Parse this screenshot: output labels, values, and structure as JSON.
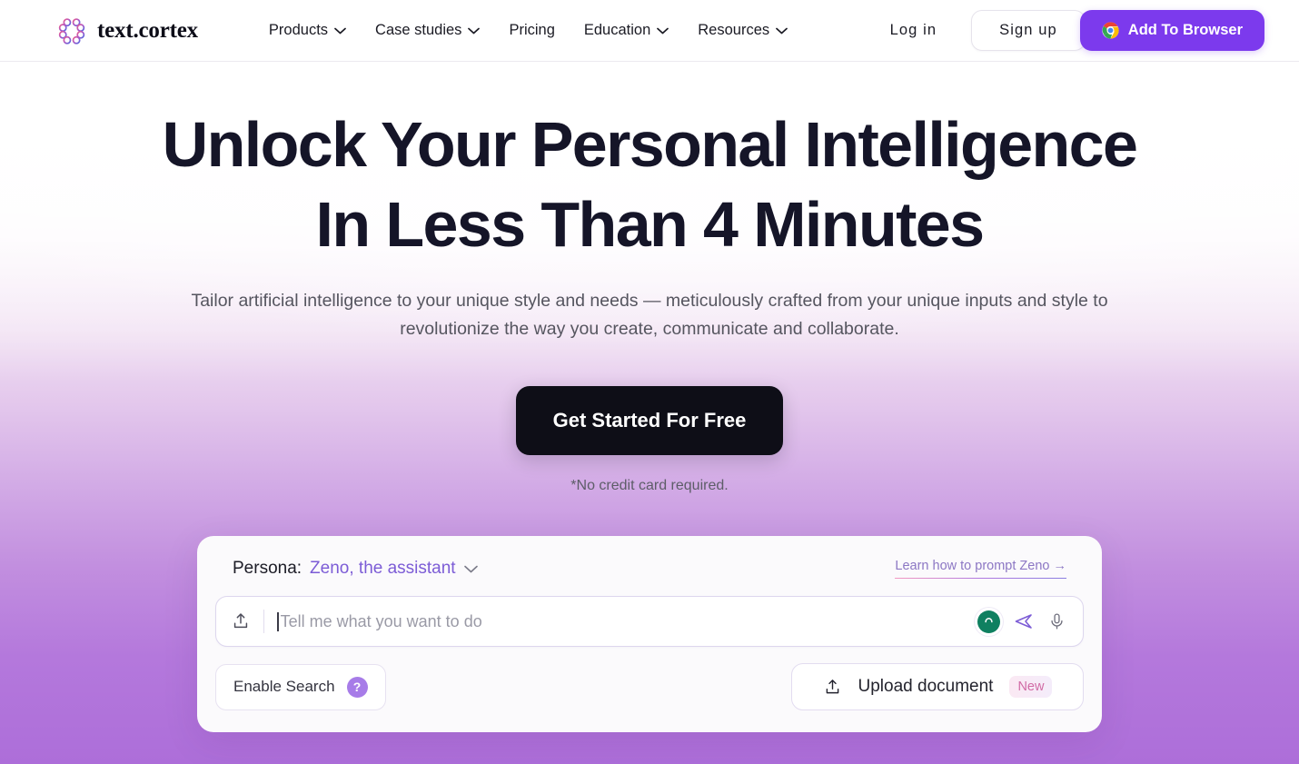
{
  "header": {
    "brand": {
      "name": "text.cortex",
      "logo_icon": "brain-flower-logo"
    },
    "nav": [
      {
        "label": "Products",
        "has_dropdown": true
      },
      {
        "label": "Case studies",
        "has_dropdown": true
      },
      {
        "label": "Pricing",
        "has_dropdown": false
      },
      {
        "label": "Education",
        "has_dropdown": true
      },
      {
        "label": "Resources",
        "has_dropdown": true
      }
    ],
    "login_label": "Log in",
    "signup_label": "Sign up",
    "add_to_browser_label": "Add To Browser",
    "add_to_browser_icon": "chrome-icon",
    "accent_color": "#7c3aed"
  },
  "hero": {
    "headline_line1": "Unlock Your Personal Intelligence",
    "headline_line2": "In Less Than 4 Minutes",
    "subhead": "Tailor artificial intelligence to your unique style and needs — meticulously crafted from your unique inputs and style to revolutionize the way you create, communicate and collaborate.",
    "cta_label": "Get Started For Free",
    "cta_note": "*No credit card required."
  },
  "prompt_card": {
    "persona_label": "Persona:",
    "persona_value": "Zeno, the assistant",
    "learn_link": "Learn how to prompt Zeno →",
    "input_placeholder": "Tell me what you want to do",
    "input_value": "",
    "upload_icon": "upload-icon",
    "avatar_icon": "zeno-avatar-icon",
    "send_icon": "send-icon",
    "mic_icon": "microphone-icon",
    "enable_search_label": "Enable Search",
    "help_badge": "?",
    "upload_document_label": "Upload document",
    "upload_document_badge": "New",
    "persona_color": "#7c5cd6",
    "avatar_color": "#0f8060"
  }
}
